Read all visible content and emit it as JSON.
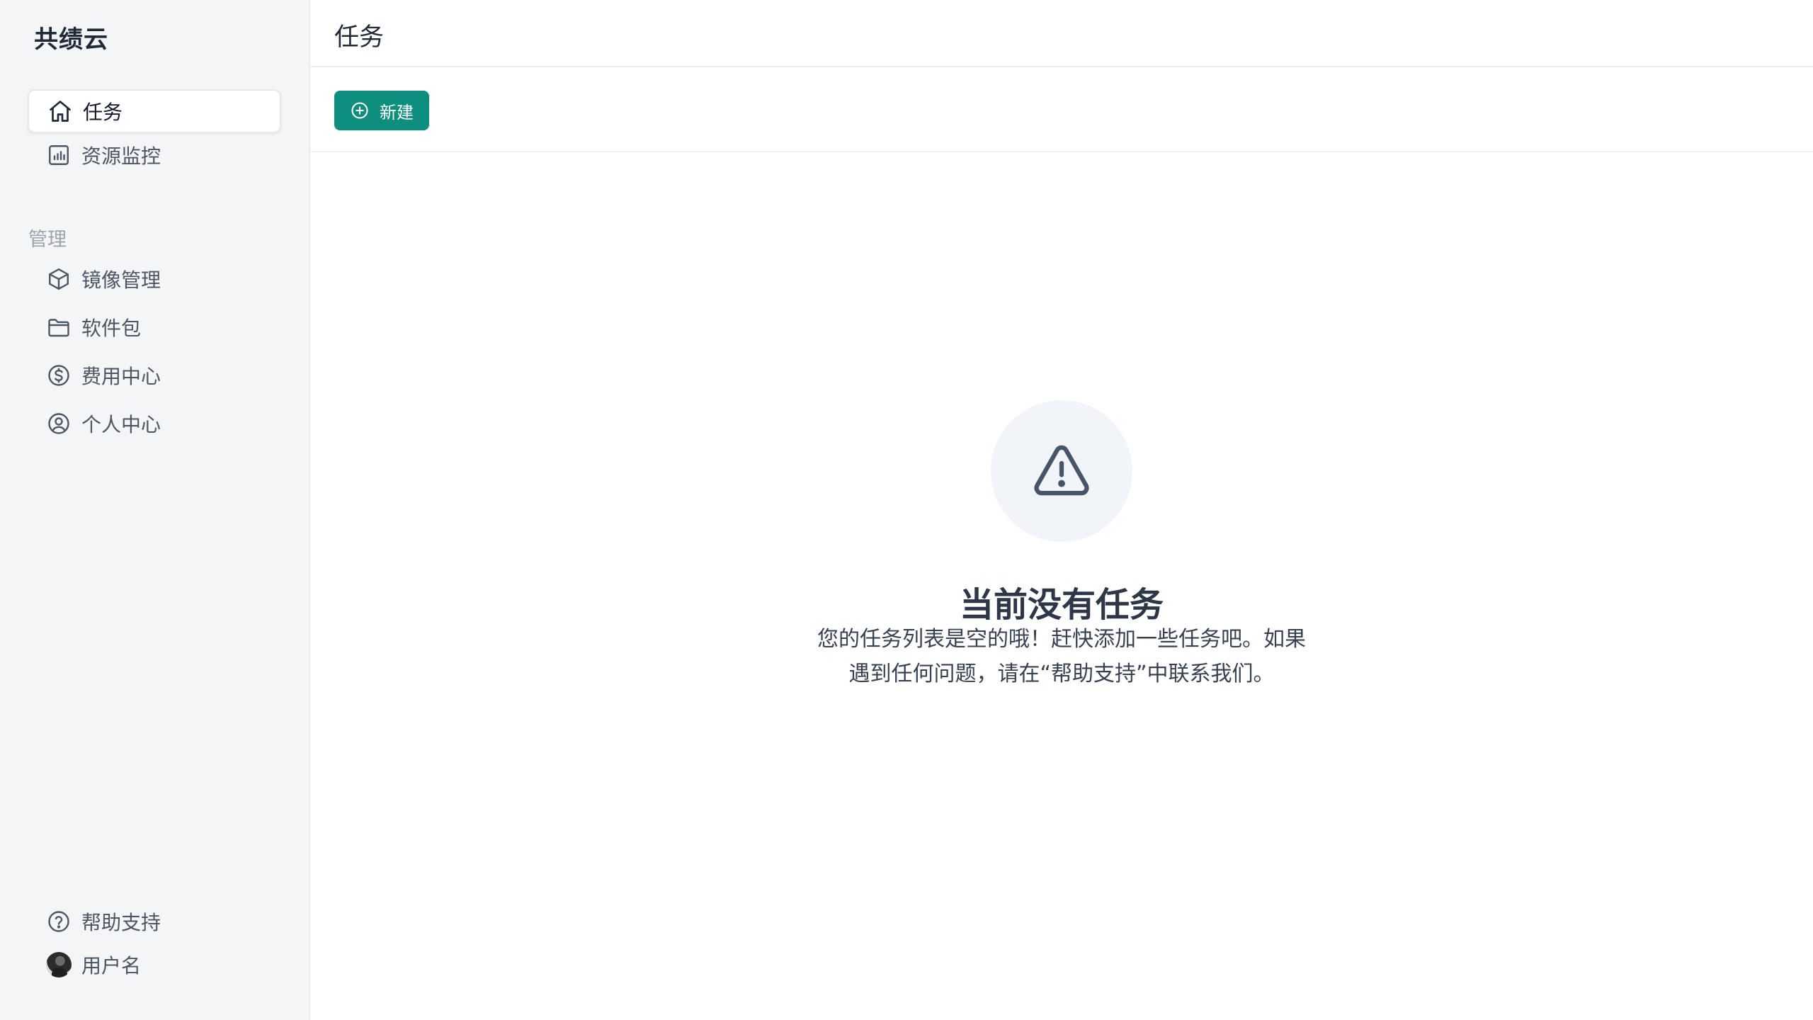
{
  "app": {
    "brand": "共绩云"
  },
  "sidebar": {
    "items": [
      {
        "label": "任务",
        "icon": "home-icon",
        "active": true
      },
      {
        "label": "资源监控",
        "icon": "chart-icon",
        "active": false
      }
    ],
    "section_label": "管理",
    "manage_items": [
      {
        "label": "镜像管理",
        "icon": "cube-icon"
      },
      {
        "label": "软件包",
        "icon": "folder-icon"
      },
      {
        "label": "费用中心",
        "icon": "dollar-icon"
      },
      {
        "label": "个人中心",
        "icon": "user-circle-icon"
      }
    ],
    "bottom_items": [
      {
        "label": "帮助支持",
        "icon": "help-icon"
      },
      {
        "label": "用户名",
        "icon": "avatar"
      }
    ]
  },
  "header": {
    "title": "任务"
  },
  "toolbar": {
    "new_label": "新建",
    "new_icon": "plus-circle-icon",
    "accent_color": "#0e8f7e"
  },
  "empty_state": {
    "icon": "warning-triangle-icon",
    "title": "当前没有任务",
    "description": "您的任务列表是空的哦！赶快添加一些任务吧。如果遇到任何问题，请在“帮助支持”中联系我们。"
  }
}
